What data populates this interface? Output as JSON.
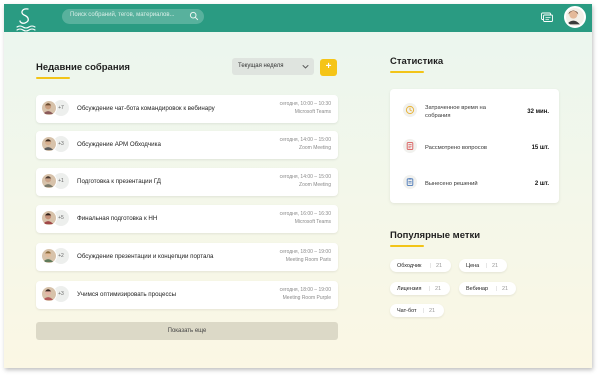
{
  "header": {
    "search_placeholder": "Поиск собраний, тегов, материалов...",
    "brand_color": "#2a9b82",
    "icons": [
      "logo-icon",
      "search-icon",
      "chat-icon",
      "user-avatar"
    ]
  },
  "recent": {
    "title": "Недавние собрания",
    "week_select": "Текущая неделя",
    "add_label": "+",
    "meetings": [
      {
        "count": "+7",
        "title": "Обсуждение чат-бота командировок к вебинару",
        "time": "сегодня, 10:00 – 10:30",
        "place": "Microsoft Teams"
      },
      {
        "count": "+3",
        "title": "Обсуждение АРМ Обходчика",
        "time": "сегодня, 14:00 – 15:00",
        "place": "Zoom Meeting"
      },
      {
        "count": "+1",
        "title": "Подготовка к презентации ГД",
        "time": "сегодня, 14:00 – 15:00",
        "place": "Zoom Meeting"
      },
      {
        "count": "+5",
        "title": "Финальная подготовка к НН",
        "time": "сегодня, 16:00 – 16:30",
        "place": "Microsoft Teams"
      },
      {
        "count": "+2",
        "title": "Обсуждение презентации и концепции портала",
        "time": "сегодня, 18:00 – 19:00",
        "place": "Meeting Room Paris"
      },
      {
        "count": "+3",
        "title": "Учимся оптимизировать процессы",
        "time": "сегодня, 18:00 – 19:00",
        "place": "Meeting Room Purple"
      }
    ],
    "show_more": "Показать еще"
  },
  "stats": {
    "title": "Статистика",
    "items": [
      {
        "label_line1": "Затраченное время на",
        "label_line2": "собрания",
        "value": "32 мин.",
        "icon": "clock-icon"
      },
      {
        "label_line1": "Рассмотрено вопросов",
        "label_line2": "",
        "value": "15 шт.",
        "icon": "questions-icon"
      },
      {
        "label_line1": "Вынесено решений",
        "label_line2": "",
        "value": "2 шт.",
        "icon": "decisions-icon"
      }
    ]
  },
  "tags": {
    "title": "Популярные метки",
    "items": [
      {
        "name": "Обходчик",
        "count": "21"
      },
      {
        "name": "Цена",
        "count": "21"
      },
      {
        "name": "Лицензия",
        "count": "21"
      },
      {
        "name": "Вебинар",
        "count": "21"
      },
      {
        "name": "Чат-бот",
        "count": "21"
      }
    ]
  },
  "colors": {
    "accent": "#f5c417",
    "brand": "#2a9b82"
  }
}
